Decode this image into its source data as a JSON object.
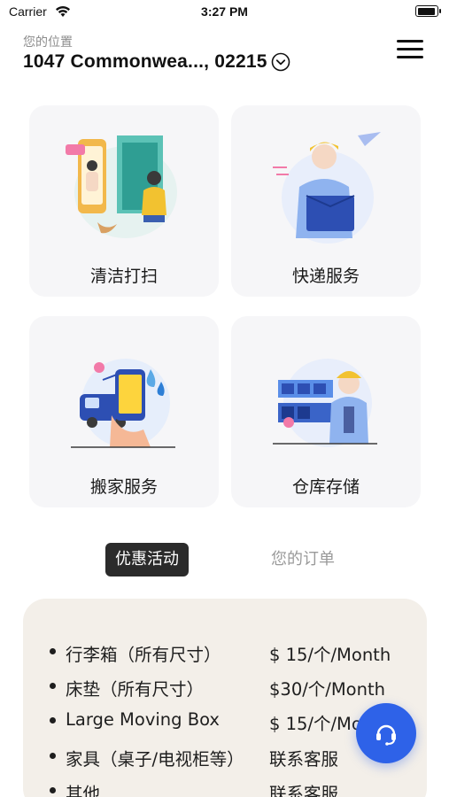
{
  "status_bar": {
    "carrier": "Carrier",
    "time": "3:27 PM"
  },
  "location": {
    "label": "您的位置",
    "address": "1047 Commonwea..., 02215"
  },
  "services": [
    {
      "label": "清洁打扫",
      "icon": "cleaning-illustration"
    },
    {
      "label": "快递服务",
      "icon": "courier-illustration"
    },
    {
      "label": "搬家服务",
      "icon": "moving-illustration"
    },
    {
      "label": "仓库存储",
      "icon": "warehouse-illustration"
    }
  ],
  "tabs": {
    "active": "优惠活动",
    "inactive": "您的订单"
  },
  "promotions": [
    {
      "item": "行李箱（所有尺寸）",
      "price": "$ 15/个/Month"
    },
    {
      "item": "床垫（所有尺寸）",
      "price": "$30/个/Month"
    },
    {
      "item": "Large Moving Box",
      "price": "$ 15/个/Month"
    },
    {
      "item": "家具（桌子/电视柜等）",
      "price": "联系客服"
    },
    {
      "item": "其他",
      "price": "联系客服"
    }
  ],
  "colors": {
    "accent": "#2e62e8",
    "tab_active_bg": "#2b2b2b",
    "card_bg": "#f6f6f8",
    "promo_bg": "#f3efe9"
  },
  "icons": [
    "wifi-icon",
    "battery-icon",
    "chevron-down-icon",
    "menu-icon",
    "headset-icon"
  ]
}
